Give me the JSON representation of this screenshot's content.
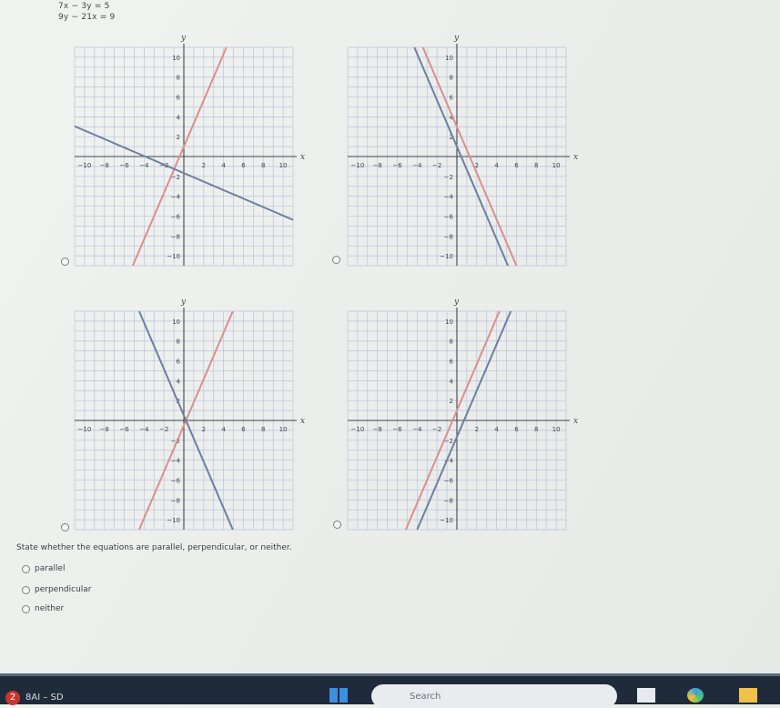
{
  "equations": {
    "eq1": "7x − 3y = 5",
    "eq2": "9y − 21x = 9"
  },
  "axis_labels": {
    "x": "x",
    "y": "y"
  },
  "tick_labels": [
    "−10",
    "−8",
    "−6",
    "−4",
    "−2",
    "2",
    "4",
    "6",
    "8",
    "10"
  ],
  "colors": {
    "red_line": "#d9908d",
    "blue_line": "#6e7fa0",
    "grid": "#b8c3de",
    "axis": "#3f4350"
  },
  "graphs": [
    {
      "id": "top-left",
      "lines": [
        {
          "color": "red",
          "slope": 2.333,
          "intercept": 1.0
        },
        {
          "color": "blue",
          "slope": -0.4286,
          "intercept": -1.667
        }
      ]
    },
    {
      "id": "top-right",
      "lines": [
        {
          "color": "red",
          "slope": -2.333,
          "intercept": 3.0
        },
        {
          "color": "blue",
          "slope": -2.333,
          "intercept": 1.0
        }
      ]
    },
    {
      "id": "bottom-left",
      "lines": [
        {
          "color": "red",
          "slope": 2.333,
          "intercept": -0.5
        },
        {
          "color": "blue",
          "slope": -2.333,
          "intercept": 0.5
        }
      ]
    },
    {
      "id": "bottom-right",
      "lines": [
        {
          "color": "red",
          "slope": 2.333,
          "intercept": 1.0
        },
        {
          "color": "blue",
          "slope": 2.333,
          "intercept": -1.667
        }
      ]
    }
  ],
  "question": "State whether the equations are parallel, perpendicular, or neither.",
  "options": [
    "parallel",
    "perpendicular",
    "neither"
  ],
  "taskbar": {
    "badge": "2",
    "label": "8AI – SD",
    "search": "Search"
  }
}
